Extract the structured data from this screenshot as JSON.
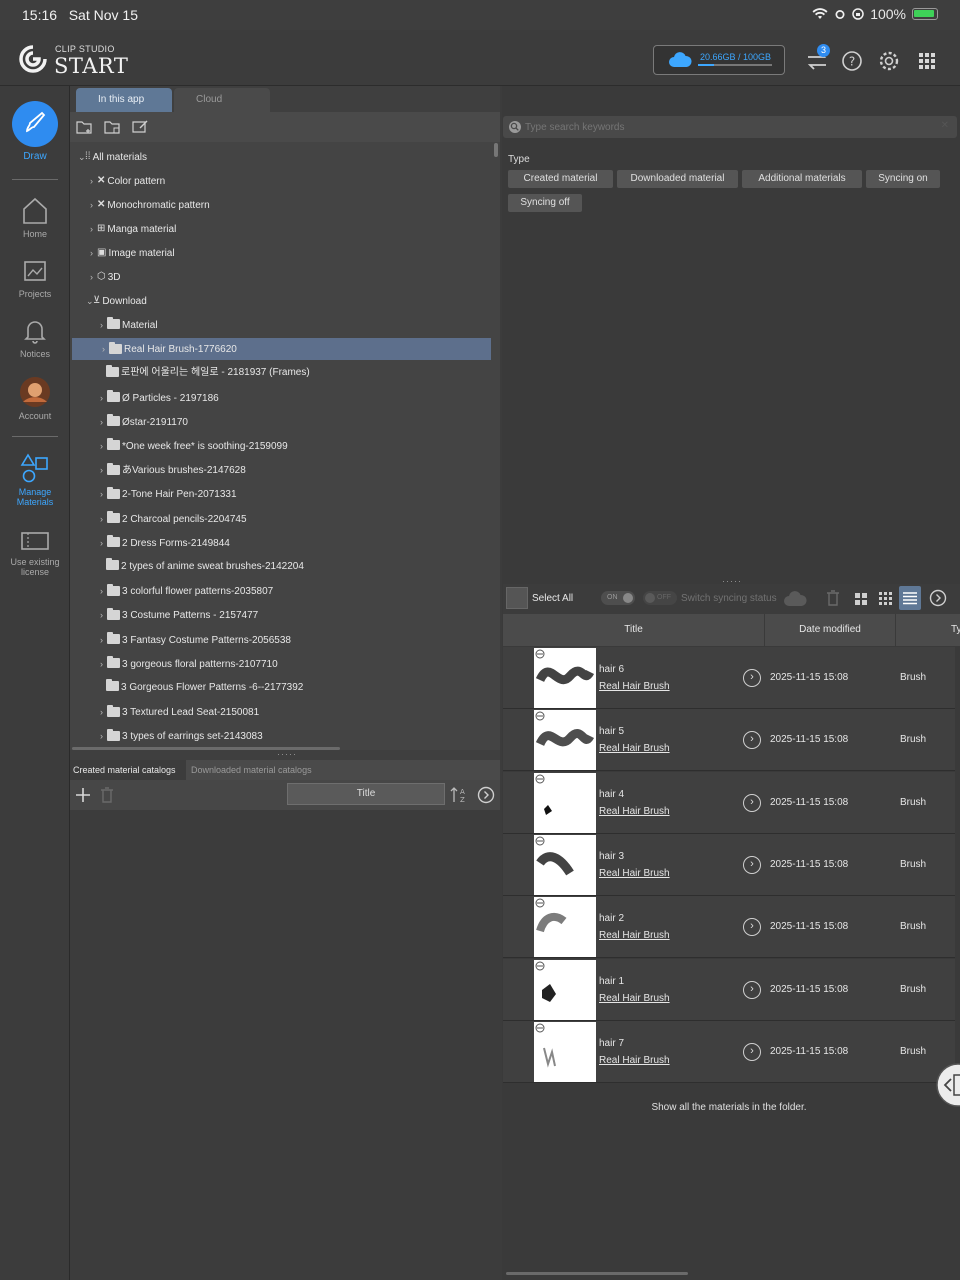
{
  "status_bar": {
    "time": "15:16",
    "date": "Sat Nov 15",
    "battery": "100%"
  },
  "app": {
    "logo_small": "CLIP STUDIO",
    "logo_big": "START"
  },
  "header": {
    "storage": "20.66GB / 100GB",
    "storage_fraction": 0.21,
    "sync_badge": "3"
  },
  "sidebar": {
    "draw": "Draw",
    "home": "Home",
    "projects": "Projects",
    "notices": "Notices",
    "account": "Account",
    "manage_line1": "Manage",
    "manage_line2": "Materials",
    "license_line1": "Use existing",
    "license_line2": "license"
  },
  "tabs": {
    "in_app": "In this app",
    "cloud": "Cloud"
  },
  "tree": {
    "all": "All materials",
    "color": "Color pattern",
    "mono": "Monochromatic pattern",
    "manga": "Manga material",
    "image": "Image material",
    "threed": "3D",
    "download": "Download",
    "items": [
      "Material",
      "Real Hair Brush-1776620",
      "로판에 어울리는 헤일로 - 2181937 (Frames)",
      "Ø Particles - 2197186",
      "Østar-2191170",
      "*One week free* is soothing-2159099",
      "あVarious brushes-2147628",
      "2-Tone Hair Pen-2071331",
      "2 Charcoal pencils-2204745",
      "2 Dress Forms-2149844",
      "2 types of anime sweat brushes-2142204",
      "3 colorful flower patterns-2035807",
      "3 Costume Patterns - 2157477",
      "3 Fantasy Costume Patterns-2056538",
      "3 gorgeous floral patterns-2107710",
      "3 Gorgeous Flower Patterns -6--2177392",
      "3 Textured Lead Seat-2150081",
      "3 types of earrings set-2143083"
    ]
  },
  "catalog": {
    "created": "Created material catalogs",
    "downloaded": "Downloaded material catalogs",
    "title_btn": "Title"
  },
  "search": {
    "placeholder": "Type search keywords"
  },
  "filter": {
    "type_label": "Type",
    "chips": [
      "Created material",
      "Downloaded material",
      "Additional materials",
      "Syncing on",
      "Syncing off"
    ]
  },
  "list_toolbar": {
    "select_all": "Select All",
    "on": "ON",
    "off": "OFF",
    "switch_sync": "Switch syncing status"
  },
  "table": {
    "headers": [
      "Title",
      "Date modified",
      "Ty"
    ],
    "rows": [
      {
        "name": "hair 6",
        "folder": "Real Hair Brush",
        "date": "2025-11-15 15:08",
        "type": "Brush"
      },
      {
        "name": "hair 5",
        "folder": "Real Hair Brush",
        "date": "2025-11-15 15:08",
        "type": "Brush"
      },
      {
        "name": "hair 4",
        "folder": "Real Hair Brush",
        "date": "2025-11-15 15:08",
        "type": "Brush"
      },
      {
        "name": "hair 3",
        "folder": "Real Hair Brush",
        "date": "2025-11-15 15:08",
        "type": "Brush"
      },
      {
        "name": "hair 2",
        "folder": "Real Hair Brush",
        "date": "2025-11-15 15:08",
        "type": "Brush"
      },
      {
        "name": "hair 1",
        "folder": "Real Hair Brush",
        "date": "2025-11-15 15:08",
        "type": "Brush"
      },
      {
        "name": "hair 7",
        "folder": "Real Hair Brush",
        "date": "2025-11-15 15:08",
        "type": "Brush"
      }
    ],
    "footer": "Show all the materials in the folder."
  },
  "colors": {
    "accent": "#3da7ff",
    "selected_row": "#5d6f8c",
    "tab_active": "#5f7896"
  }
}
